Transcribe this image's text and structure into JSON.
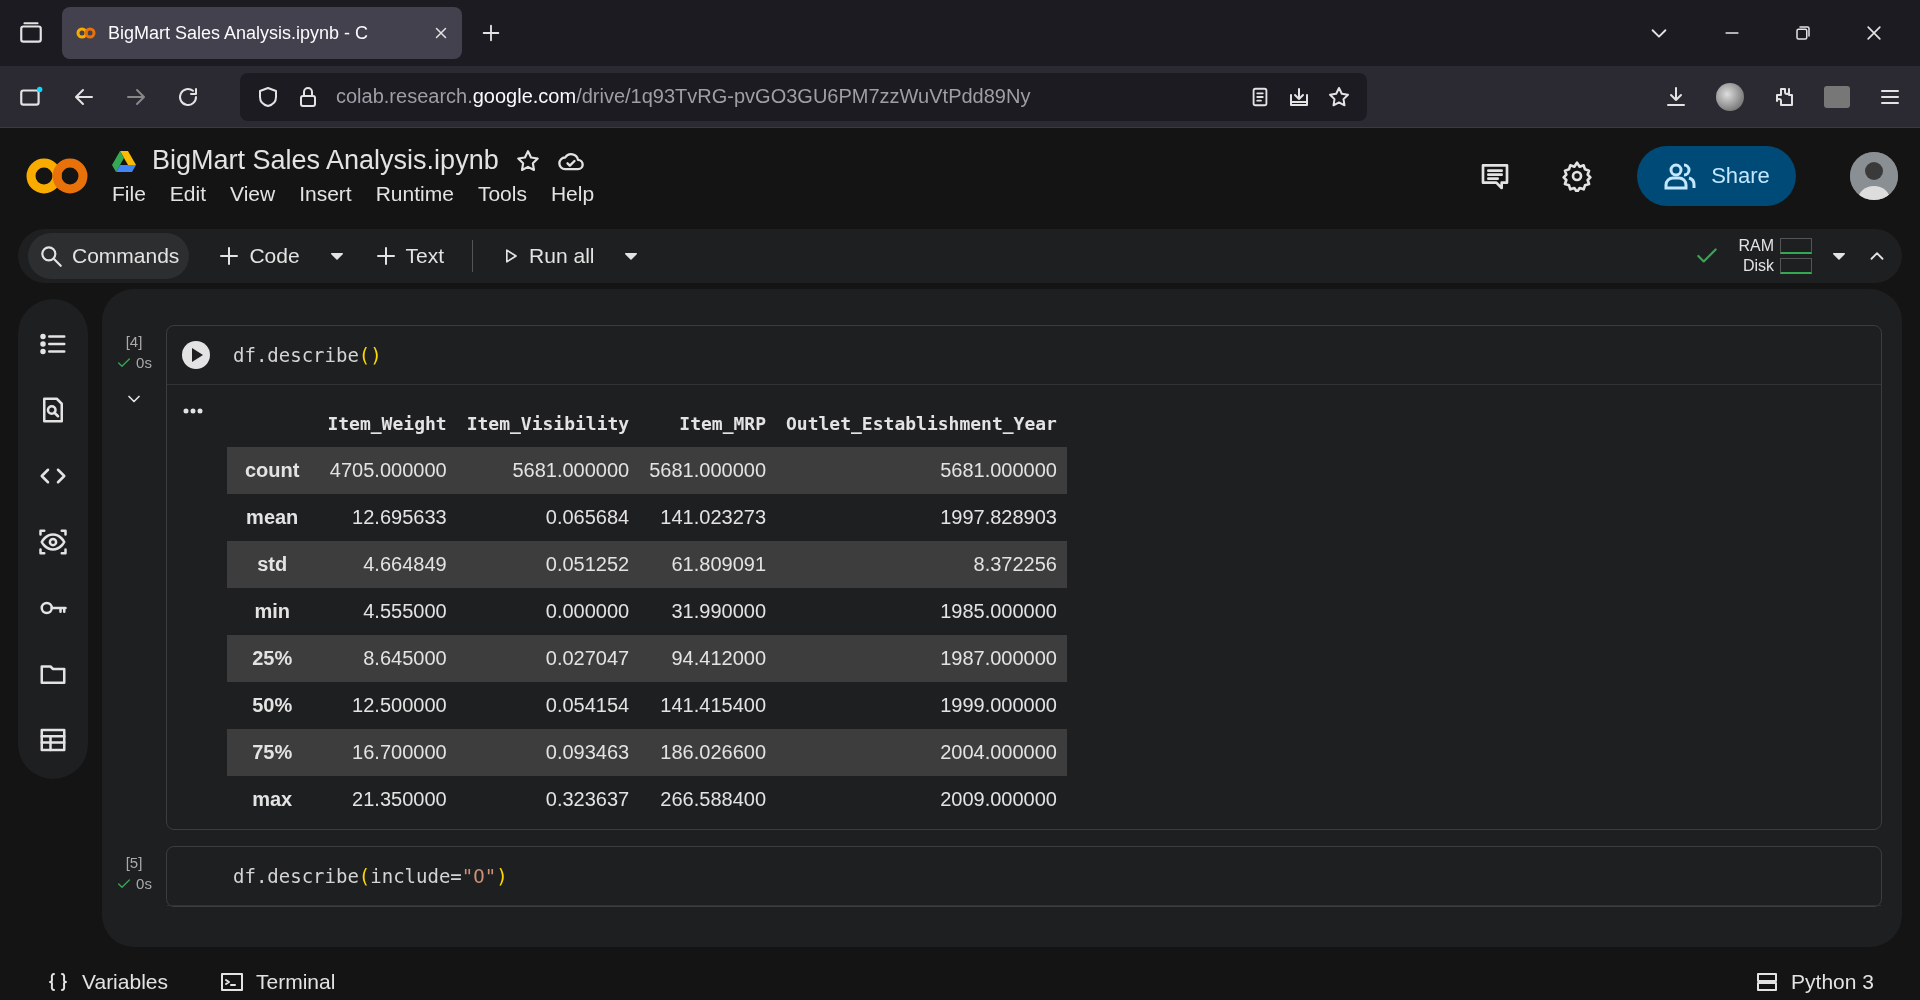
{
  "browser": {
    "tab_title": "BigMart Sales Analysis.ipynb - C",
    "url": {
      "prefix": "colab.research.",
      "domain": "google.com",
      "path": "/drive/1q93TvRG-pvGO3GU6PM7zzWuVtPdd89Ny"
    }
  },
  "notebook": {
    "title": "BigMart Sales Analysis.ipynb",
    "menu": [
      "File",
      "Edit",
      "View",
      "Insert",
      "Runtime",
      "Tools",
      "Help"
    ],
    "share": "Share"
  },
  "toolbar": {
    "commands": "Commands",
    "code": "Code",
    "text": "Text",
    "run_all": "Run all",
    "resources": [
      "RAM",
      "Disk"
    ]
  },
  "cells": [
    {
      "count": "[4]",
      "time": "0s",
      "code": [
        {
          "kind": "plain",
          "text": "df.describe"
        },
        {
          "kind": "paren",
          "text": "()"
        }
      ],
      "output": {
        "columns": [
          "Item_Weight",
          "Item_Visibility",
          "Item_MRP",
          "Outlet_Establishment_Year"
        ],
        "rows": [
          {
            "label": "count",
            "values": [
              "4705.000000",
              "5681.000000",
              "5681.000000",
              "5681.000000"
            ]
          },
          {
            "label": "mean",
            "values": [
              "12.695633",
              "0.065684",
              "141.023273",
              "1997.828903"
            ]
          },
          {
            "label": "std",
            "values": [
              "4.664849",
              "0.051252",
              "61.809091",
              "8.372256"
            ]
          },
          {
            "label": "min",
            "values": [
              "4.555000",
              "0.000000",
              "31.990000",
              "1985.000000"
            ]
          },
          {
            "label": "25%",
            "values": [
              "8.645000",
              "0.027047",
              "94.412000",
              "1987.000000"
            ]
          },
          {
            "label": "50%",
            "values": [
              "12.500000",
              "0.054154",
              "141.415400",
              "1999.000000"
            ]
          },
          {
            "label": "75%",
            "values": [
              "16.700000",
              "0.093463",
              "186.026600",
              "2004.000000"
            ]
          },
          {
            "label": "max",
            "values": [
              "21.350000",
              "0.323637",
              "266.588400",
              "2009.000000"
            ]
          }
        ]
      }
    },
    {
      "count": "[5]",
      "time": "0s",
      "code": [
        {
          "kind": "plain",
          "text": "df.describe"
        },
        {
          "kind": "paren",
          "text": "("
        },
        {
          "kind": "plain",
          "text": "include="
        },
        {
          "kind": "string",
          "text": "\"O\""
        },
        {
          "kind": "paren",
          "text": ")"
        }
      ]
    }
  ],
  "status_bar": {
    "items": [
      "Variables",
      "Terminal"
    ],
    "runtime": "Python 3"
  }
}
